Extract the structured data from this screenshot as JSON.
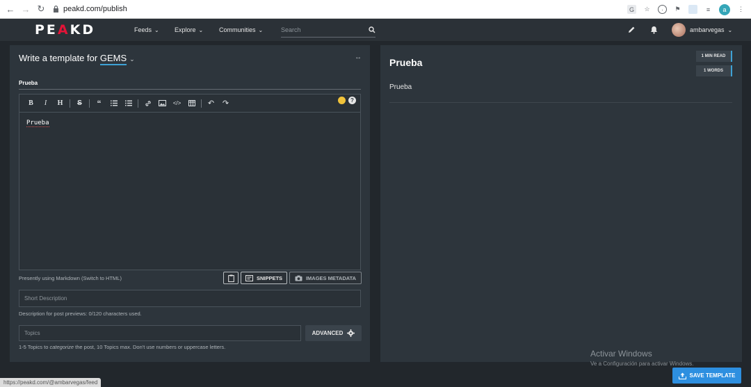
{
  "browser": {
    "url": "peakd.com/publish",
    "status_url": "https://peakd.com/@ambarvegas/feed",
    "profile_initial": "a"
  },
  "header": {
    "logo_text_a": "PE",
    "logo_text_b": "A",
    "logo_text_c": "KD",
    "menu": [
      {
        "label": "Feeds"
      },
      {
        "label": "Explore"
      },
      {
        "label": "Communities"
      }
    ],
    "search_placeholder": "Search",
    "username": "ambarvegas"
  },
  "editor": {
    "heading_prefix": "Write a template for",
    "community": "GEMS",
    "title_value": "Prueba",
    "body_text": "Prueba",
    "markdown_note": "Presently using Markdown (Switch to HTML)",
    "snippets_label": "SNIPPETS",
    "images_metadata_label": "IMAGES METADATA",
    "short_description_placeholder": "Short Description",
    "description_note": "Description for post previews: 0/120 characters used.",
    "topics_placeholder": "Topics",
    "advanced_label": "ADVANCED",
    "topics_note_a": "1-5 Topics to ",
    "topics_note_em": "categorize",
    "topics_note_b": " the post, 10 Topics max. Don't use numbers or uppercase letters."
  },
  "preview": {
    "title": "Prueba",
    "read_time": "1 MIN READ",
    "word_count": "1 WORDS",
    "body": "Prueba"
  },
  "footer": {
    "save_label": "SAVE TEMPLATE",
    "activate_title": "Activar Windows",
    "activate_sub": "Ve a Configuración para activar Windows."
  },
  "colors": {
    "brand_red": "#e31337",
    "accent_blue": "#3ea2d5",
    "save_blue": "#2d8fe0"
  }
}
